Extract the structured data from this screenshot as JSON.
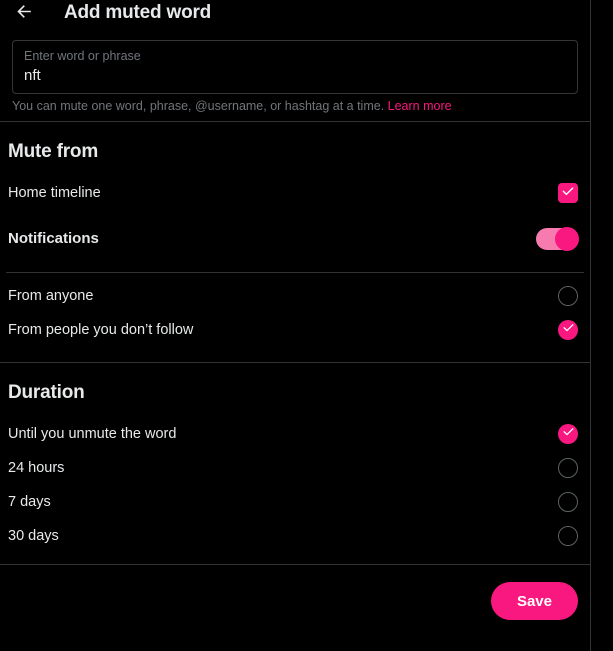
{
  "header": {
    "back_icon": "arrow-left-icon",
    "title": "Add muted word"
  },
  "word_input": {
    "label": "Enter word or phrase",
    "value": "nft",
    "placeholder": "Enter word or phrase"
  },
  "helper": {
    "text": "You can mute one word, phrase, @username, or hashtag at a time.",
    "link_label": "Learn more"
  },
  "mute_from": {
    "title": "Mute from",
    "home_timeline": {
      "label": "Home timeline",
      "control": "checkbox",
      "checked": true
    },
    "notifications": {
      "label": "Notifications",
      "control": "toggle",
      "on": true
    },
    "audience": [
      {
        "label": "From anyone",
        "selected": false
      },
      {
        "label": "From people you don’t follow",
        "selected": true
      }
    ]
  },
  "duration": {
    "title": "Duration",
    "options": [
      {
        "label": "Until you unmute the word",
        "selected": true
      },
      {
        "label": "24 hours",
        "selected": false
      },
      {
        "label": "7 days",
        "selected": false
      },
      {
        "label": "30 days",
        "selected": false
      }
    ]
  },
  "footer": {
    "save_label": "Save"
  },
  "colors": {
    "accent": "#f91880",
    "accent_track": "#f87bb0",
    "background": "#000000",
    "text": "#e7e9ea",
    "muted_text": "#71767b",
    "border": "#2f3336"
  }
}
